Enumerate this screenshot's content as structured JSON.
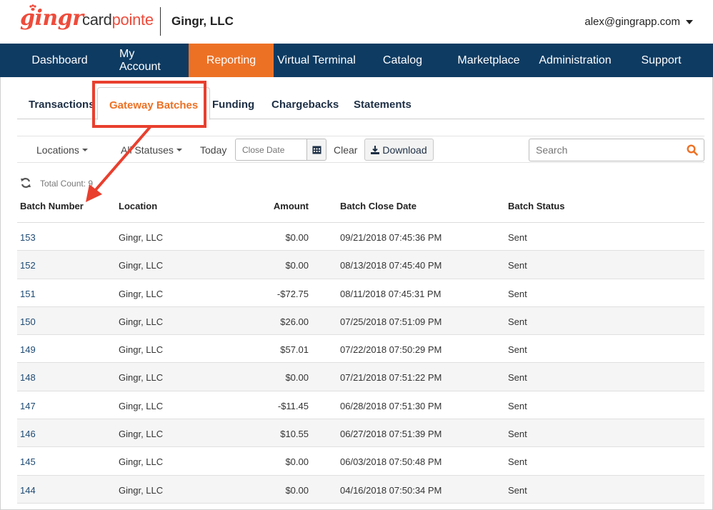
{
  "header": {
    "logo_gingr": "gingr",
    "logo_card_part": "card",
    "logo_pointe_part": "pointe",
    "company": "Gingr, LLC",
    "user_email": "alex@gingrapp.com"
  },
  "nav": {
    "items": [
      {
        "label": "Dashboard",
        "active": false
      },
      {
        "label": "My Account",
        "active": false
      },
      {
        "label": "Reporting",
        "active": true
      },
      {
        "label": "Virtual Terminal",
        "active": false
      },
      {
        "label": "Catalog",
        "active": false
      },
      {
        "label": "Marketplace",
        "active": false
      },
      {
        "label": "Administration",
        "active": false
      },
      {
        "label": "Support",
        "active": false
      }
    ]
  },
  "subtabs": {
    "transactions": "Transactions",
    "gateway_batches": "Gateway Batches",
    "funding": "Funding",
    "chargebacks": "Chargebacks",
    "statements": "Statements"
  },
  "toolbar": {
    "locations": "Locations",
    "statuses": "All Statuses",
    "today": "Today",
    "date_placeholder": "Close Date",
    "clear": "Clear",
    "download": "Download",
    "search_placeholder": "Search"
  },
  "total_count_label": "Total Count: 9",
  "table": {
    "headers": {
      "batch": "Batch Number",
      "location": "Location",
      "amount": "Amount",
      "close_date": "Batch Close Date",
      "status": "Batch Status"
    },
    "rows": [
      {
        "batch": "153",
        "location": "Gingr, LLC",
        "amount": "$0.00",
        "close_date": "09/21/2018 07:45:36 PM",
        "status": "Sent"
      },
      {
        "batch": "152",
        "location": "Gingr, LLC",
        "amount": "$0.00",
        "close_date": "08/13/2018 07:45:40 PM",
        "status": "Sent"
      },
      {
        "batch": "151",
        "location": "Gingr, LLC",
        "amount": "-$72.75",
        "close_date": "08/11/2018 07:45:31 PM",
        "status": "Sent"
      },
      {
        "batch": "150",
        "location": "Gingr, LLC",
        "amount": "$26.00",
        "close_date": "07/25/2018 07:51:09 PM",
        "status": "Sent"
      },
      {
        "batch": "149",
        "location": "Gingr, LLC",
        "amount": "$57.01",
        "close_date": "07/22/2018 07:50:29 PM",
        "status": "Sent"
      },
      {
        "batch": "148",
        "location": "Gingr, LLC",
        "amount": "$0.00",
        "close_date": "07/21/2018 07:51:22 PM",
        "status": "Sent"
      },
      {
        "batch": "147",
        "location": "Gingr, LLC",
        "amount": "-$11.45",
        "close_date": "06/28/2018 07:51:30 PM",
        "status": "Sent"
      },
      {
        "batch": "146",
        "location": "Gingr, LLC",
        "amount": "$10.55",
        "close_date": "06/27/2018 07:51:39 PM",
        "status": "Sent"
      },
      {
        "batch": "145",
        "location": "Gingr, LLC",
        "amount": "$0.00",
        "close_date": "06/03/2018 07:50:48 PM",
        "status": "Sent"
      },
      {
        "batch": "144",
        "location": "Gingr, LLC",
        "amount": "$0.00",
        "close_date": "04/16/2018 07:50:34 PM",
        "status": "Sent"
      }
    ]
  },
  "colors": {
    "nav_bg": "#0e3b62",
    "accent_orange": "#ed7125",
    "annotation_red": "#e93f2e",
    "brand_red": "#ee4b3b"
  },
  "icons": {
    "user_menu": "caret-down-icon",
    "calendar": "calendar-icon",
    "download": "download-icon",
    "search": "search-icon",
    "refresh": "refresh-icon"
  }
}
